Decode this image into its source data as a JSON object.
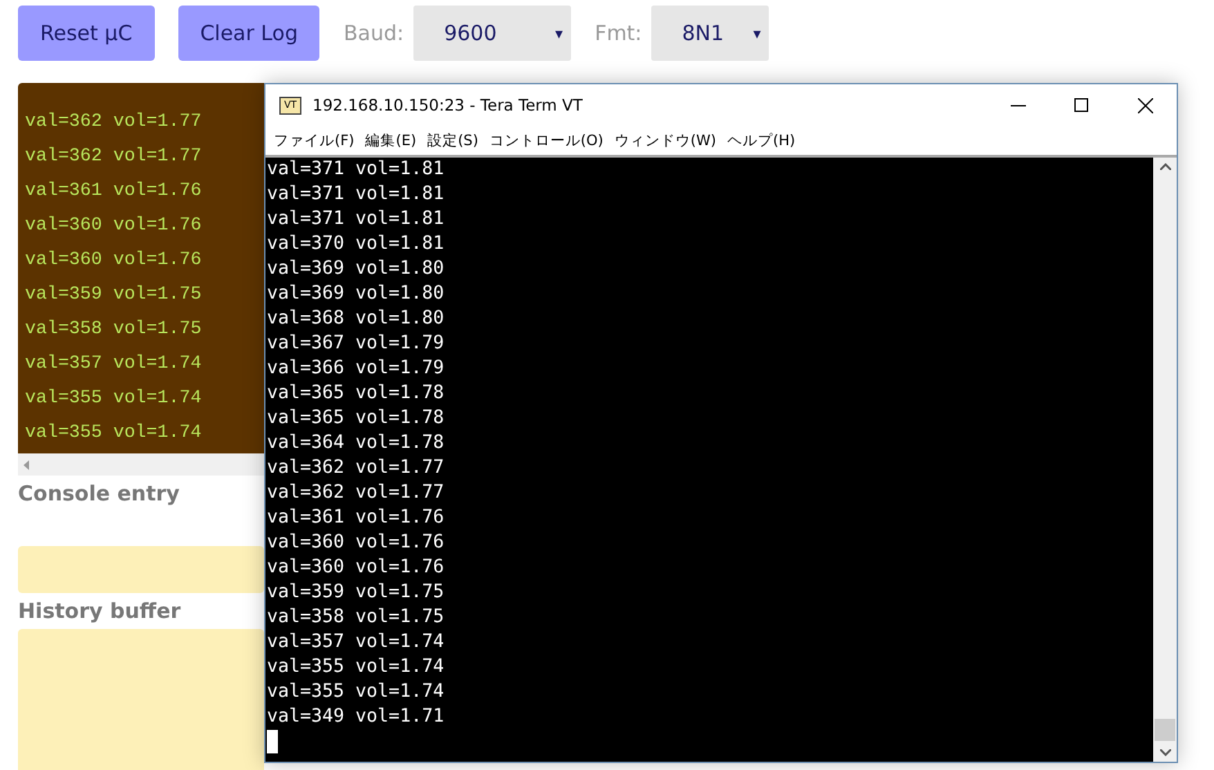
{
  "toolbar": {
    "buttons": [
      "Reset µC",
      "Clear Log"
    ],
    "selects": [
      {
        "label": "Baud:",
        "value": "9600",
        "arrow": "▾"
      },
      {
        "label": "Fmt:",
        "value": "8N1",
        "arrow": "▾"
      }
    ]
  },
  "log": {
    "lines": [
      "val=362 vol=1.77",
      "val=362 vol=1.77",
      "val=361 vol=1.76",
      "val=360 vol=1.76",
      "val=360 vol=1.76",
      "val=359 vol=1.75",
      "val=358 vol=1.75",
      "val=357 vol=1.74",
      "val=355 vol=1.74",
      "val=355 vol=1.74"
    ]
  },
  "console_entry": {
    "heading": "Console entry"
  },
  "history_buffer": {
    "heading": "History buffer"
  },
  "terminal_window": {
    "title": "192.168.10.150:23 - Tera Term VT",
    "icon_text": "VT",
    "menu": [
      "ファイル(F)",
      "編集(E)",
      "設定(S)",
      "コントロール(O)",
      "ウィンドウ(W)",
      "ヘルプ(H)"
    ],
    "lines": [
      "val=371 vol=1.81",
      "val=371 vol=1.81",
      "val=371 vol=1.81",
      "val=370 vol=1.81",
      "val=369 vol=1.80",
      "val=369 vol=1.80",
      "val=368 vol=1.80",
      "val=367 vol=1.79",
      "val=366 vol=1.79",
      "val=365 vol=1.78",
      "val=365 vol=1.78",
      "val=364 vol=1.78",
      "val=362 vol=1.77",
      "val=362 vol=1.77",
      "val=361 vol=1.76",
      "val=360 vol=1.76",
      "val=360 vol=1.76",
      "val=359 vol=1.75",
      "val=358 vol=1.75",
      "val=357 vol=1.74",
      "val=355 vol=1.74",
      "val=355 vol=1.74",
      "val=349 vol=1.71"
    ]
  }
}
